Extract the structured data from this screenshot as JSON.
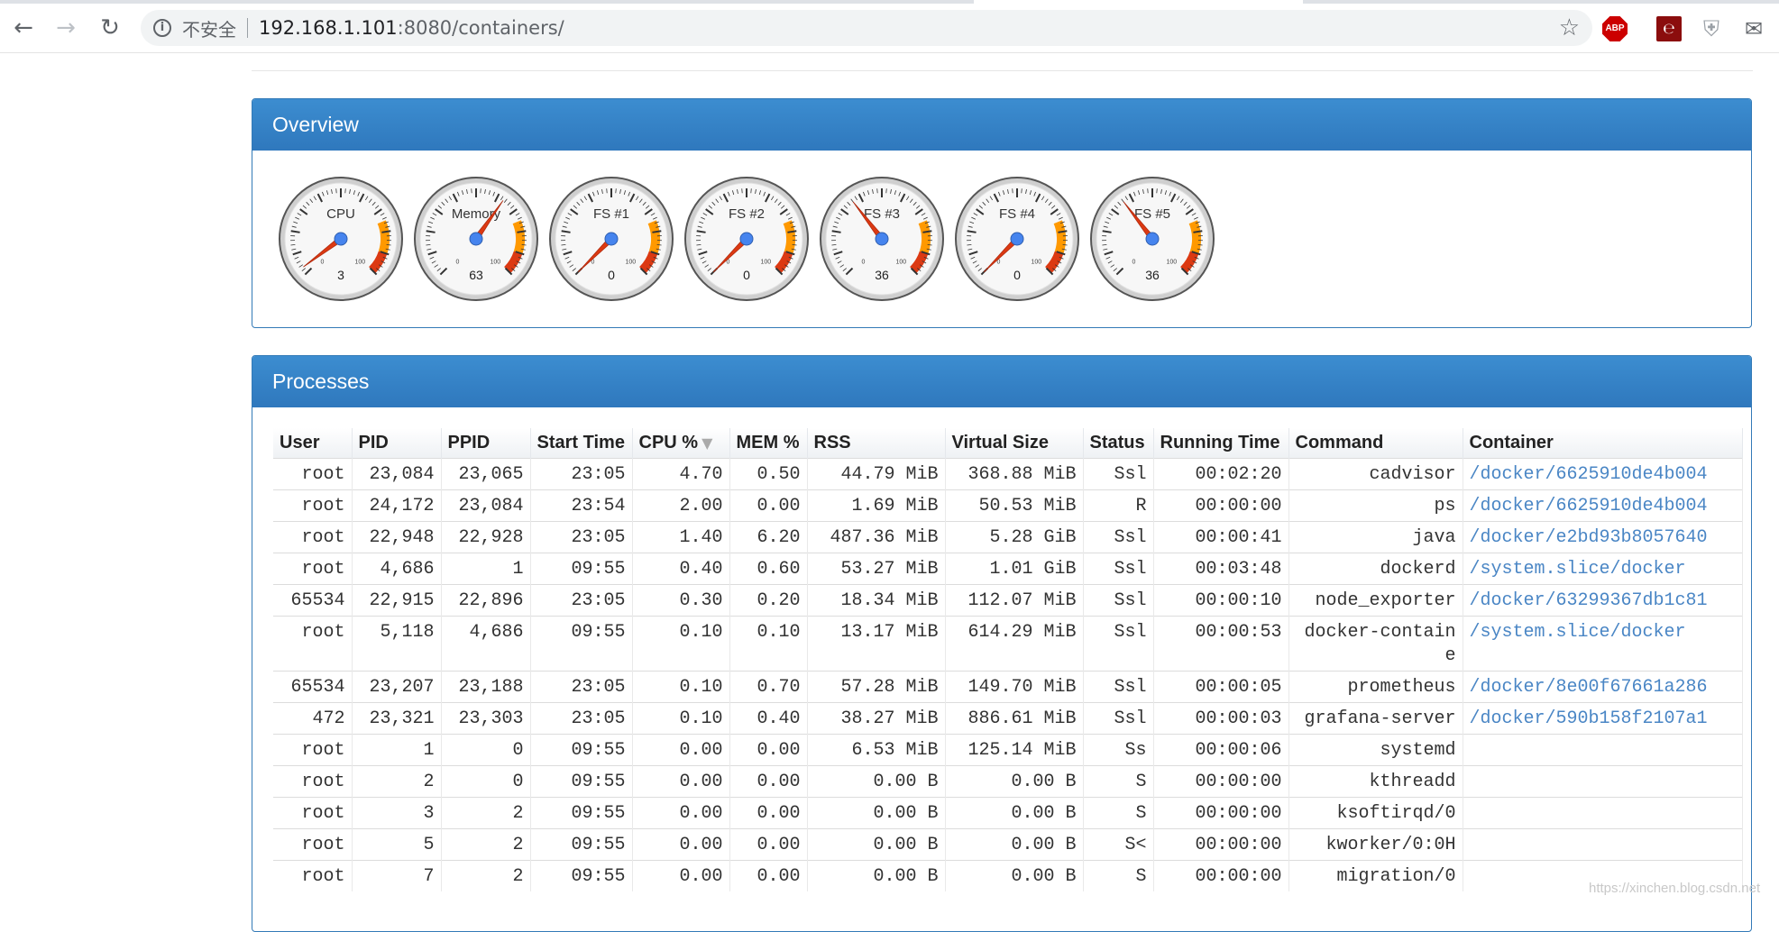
{
  "browser": {
    "insecure_label": "不安全",
    "url_host": "192.168.1.101",
    "url_rest": ":8080/containers/",
    "icons": {
      "back": "back-arrow-icon",
      "forward": "forward-arrow-icon",
      "reload": "reload-icon",
      "info": "info-icon",
      "bookmark": "star-icon"
    },
    "extensions": {
      "abp_label": "ABP"
    }
  },
  "overview": {
    "title": "Overview",
    "gauges": [
      {
        "label": "CPU",
        "value": 3
      },
      {
        "label": "Memory",
        "value": 63
      },
      {
        "label": "FS #1",
        "value": 0
      },
      {
        "label": "FS #2",
        "value": 0
      },
      {
        "label": "FS #3",
        "value": 36
      },
      {
        "label": "FS #4",
        "value": 0
      },
      {
        "label": "FS #5",
        "value": 36
      }
    ],
    "gauge_scale": {
      "min_label": "0",
      "max_label": "100"
    },
    "colors": {
      "yellow_band": "#ff9900",
      "red_band": "#dc3912",
      "needle": "#dc3912",
      "hub": "#4684ee"
    }
  },
  "processes": {
    "title": "Processes",
    "columns": [
      "User",
      "PID",
      "PPID",
      "Start Time",
      "CPU %",
      "MEM %",
      "RSS",
      "Virtual Size",
      "Status",
      "Running Time",
      "Command",
      "Container"
    ],
    "rows": [
      [
        "root",
        "23,084",
        "23,065",
        "23:05",
        "4.70",
        "0.50",
        "44.79 MiB",
        "368.88 MiB",
        "Ssl",
        "00:02:20",
        "cadvisor",
        "/docker/6625910de4b004"
      ],
      [
        "root",
        "24,172",
        "23,084",
        "23:54",
        "2.00",
        "0.00",
        "1.69 MiB",
        "50.53 MiB",
        "R",
        "00:00:00",
        "ps",
        "/docker/6625910de4b004"
      ],
      [
        "root",
        "22,948",
        "22,928",
        "23:05",
        "1.40",
        "6.20",
        "487.36 MiB",
        "5.28 GiB",
        "Ssl",
        "00:00:41",
        "java",
        "/docker/e2bd93b8057640"
      ],
      [
        "root",
        "4,686",
        "1",
        "09:55",
        "0.40",
        "0.60",
        "53.27 MiB",
        "1.01 GiB",
        "Ssl",
        "00:03:48",
        "dockerd",
        "/system.slice/docker"
      ],
      [
        "65534",
        "22,915",
        "22,896",
        "23:05",
        "0.30",
        "0.20",
        "18.34 MiB",
        "112.07 MiB",
        "Ssl",
        "00:00:10",
        "node_exporter",
        "/docker/63299367db1c81"
      ],
      [
        "root",
        "5,118",
        "4,686",
        "09:55",
        "0.10",
        "0.10",
        "13.17 MiB",
        "614.29 MiB",
        "Ssl",
        "00:00:53",
        "docker-containe",
        "/system.slice/docker"
      ],
      [
        "65534",
        "23,207",
        "23,188",
        "23:05",
        "0.10",
        "0.70",
        "57.28 MiB",
        "149.70 MiB",
        "Ssl",
        "00:00:05",
        "prometheus",
        "/docker/8e00f67661a286"
      ],
      [
        "472",
        "23,321",
        "23,303",
        "23:05",
        "0.10",
        "0.40",
        "38.27 MiB",
        "886.61 MiB",
        "Ssl",
        "00:00:03",
        "grafana-server",
        "/docker/590b158f2107a1"
      ],
      [
        "root",
        "1",
        "0",
        "09:55",
        "0.00",
        "0.00",
        "6.53 MiB",
        "125.14 MiB",
        "Ss",
        "00:00:06",
        "systemd",
        ""
      ],
      [
        "root",
        "2",
        "0",
        "09:55",
        "0.00",
        "0.00",
        "0.00 B",
        "0.00 B",
        "S",
        "00:00:00",
        "kthreadd",
        ""
      ],
      [
        "root",
        "3",
        "2",
        "09:55",
        "0.00",
        "0.00",
        "0.00 B",
        "0.00 B",
        "S",
        "00:00:00",
        "ksoftirqd/0",
        ""
      ],
      [
        "root",
        "5",
        "2",
        "09:55",
        "0.00",
        "0.00",
        "0.00 B",
        "0.00 B",
        "S<",
        "00:00:00",
        "kworker/0:0H",
        ""
      ],
      [
        "root",
        "7",
        "2",
        "09:55",
        "0.00",
        "0.00",
        "0.00 B",
        "0.00 B",
        "S",
        "00:00:00",
        "migration/0",
        ""
      ]
    ]
  },
  "watermark": "https://xinchen.blog.csdn.net"
}
